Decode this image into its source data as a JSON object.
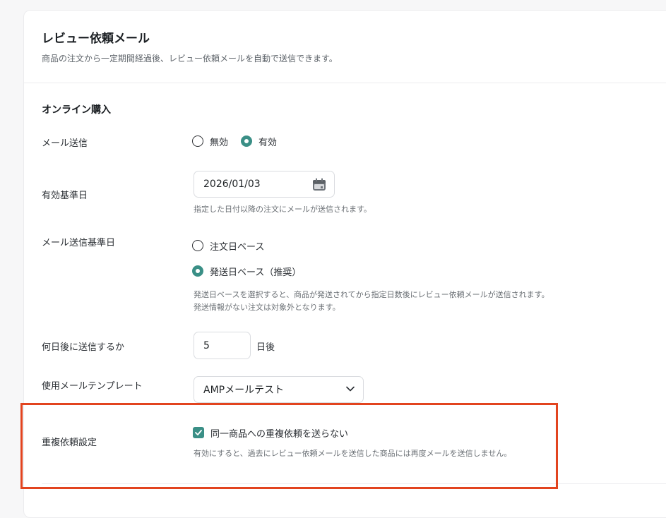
{
  "header": {
    "title": "レビュー依頼メール",
    "description": "商品の注文から一定期間経過後、レビュー依頼メールを自動で送信できます。"
  },
  "section": {
    "title": "オンライン購入"
  },
  "mail_send": {
    "label": "メール送信",
    "options": [
      "無効",
      "有効"
    ],
    "selected": "有効"
  },
  "effective_date": {
    "label": "有効基準日",
    "value": "2026/01/03",
    "hint": "指定した日付以降の注文にメールが送信されます。"
  },
  "send_basis": {
    "label": "メール送信基準日",
    "options": [
      "注文日ベース",
      "発送日ベース（推奨）"
    ],
    "selected": "発送日ベース（推奨）",
    "hint_line1": "発送日ベースを選択すると、商品が発送されてから指定日数後にレビュー依頼メールが送信されます。",
    "hint_line2": "発送情報がない注文は対象外となります。"
  },
  "days_after": {
    "label": "何日後に送信するか",
    "value": "5",
    "suffix": "日後"
  },
  "template": {
    "label": "使用メールテンプレート",
    "value": "AMPメールテスト"
  },
  "duplicate": {
    "label": "重複依頼設定",
    "checkbox_label": "同一商品への重複依頼を送らない",
    "checked": true,
    "hint": "有効にすると、過去にレビュー依頼メールを送信した商品には再度メールを送信しません。"
  },
  "colors": {
    "accent": "#3a8f86",
    "highlight": "#e2441f"
  }
}
